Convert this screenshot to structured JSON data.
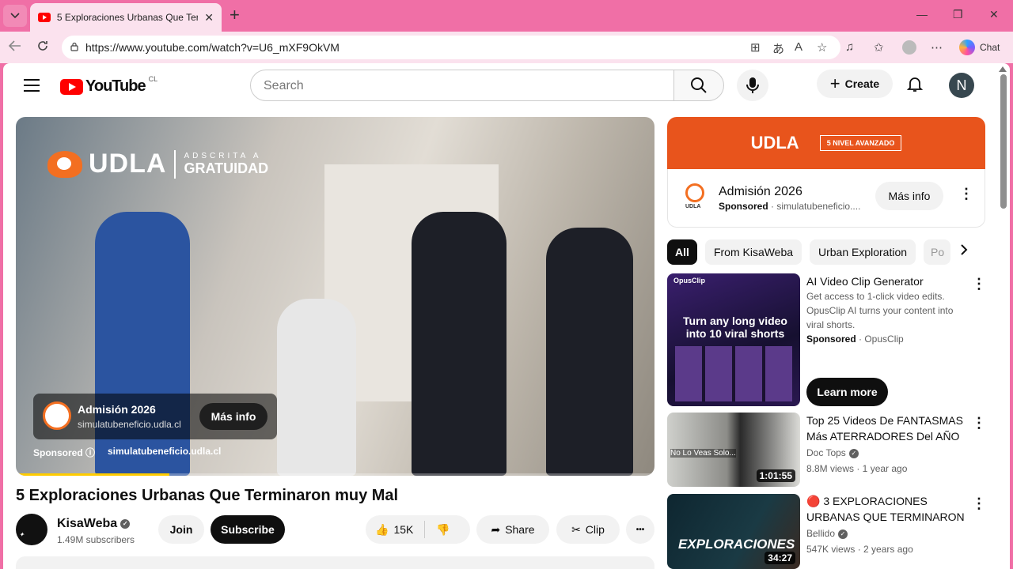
{
  "browser": {
    "tab_title": "5 Exploraciones Urbanas Que Termi",
    "tab_close": "✕",
    "new_tab": "+",
    "url": "https://www.youtube.com/watch?v=U6_mXF9OkVM",
    "chat_label": "Chat",
    "win_min": "—",
    "win_restore": "❐",
    "win_close": "✕"
  },
  "header": {
    "logo_text": "YouTube",
    "country_code": "CL",
    "search_placeholder": "Search",
    "create_label": "Create",
    "avatar_letter": "N"
  },
  "video": {
    "overlay_brand": "UDLA",
    "overlay_sub1": "ADSCRITA A",
    "overlay_sub2": "GRATUIDAD",
    "ad_title": "Admisión 2026",
    "ad_url": "simulatubeneficio.udla.cl",
    "ad_button": "Más info",
    "sponsored": "Sponsored ⓘ",
    "sponsored_url": "simulatubeneficio.udla.cl",
    "progress": 0.24,
    "title": "5 Exploraciones Urbanas Que Terminaron muy Mal",
    "channel": "KisaWeba",
    "subscribers": "1.49M subscribers",
    "join": "Join",
    "subscribe": "Subscribe",
    "likes": "15K",
    "share": "Share",
    "clip": "Clip",
    "more": "•••"
  },
  "sidebar_ad": {
    "banner_brand": "UDLA",
    "banner_badge": "5 NIVEL AVANZADO",
    "title": "Admisión 2026",
    "sponsored": "Sponsored",
    "url": "simulatubeneficio....",
    "button": "Más info"
  },
  "chips": [
    "All",
    "From KisaWeba",
    "Urban Exploration",
    "Po"
  ],
  "recommendations": [
    {
      "title": "AI Video Clip Generator",
      "description": "Get access to 1-click video edits. OpusClip AI turns your content into viral shorts.",
      "sponsored": "Sponsored",
      "advertiser": "· OpusClip",
      "cta": "Learn more",
      "thumb_text": "Turn any long video into 10 viral shorts",
      "thumb_brand": "OpusClip"
    },
    {
      "title": "Top 25 Videos De FANTASMAS Más ATERRADORES Del AÑO",
      "channel": "Doc Tops",
      "meta": "8.8M views · 1 year ago",
      "duration": "1:01:55",
      "thumb_text": "No Lo Veas Solo..."
    },
    {
      "title": "🔴 3 EXPLORACIONES URBANAS QUE TERMINARON ...",
      "channel": "Bellido",
      "meta": "547K views · 2 years ago",
      "duration": "34:27",
      "thumb_text": "EXPLORACIONES"
    }
  ],
  "colors": {
    "browser_frame": "#f06fa6",
    "youtube_red": "#ff0000",
    "udla_orange": "#e8541c"
  }
}
